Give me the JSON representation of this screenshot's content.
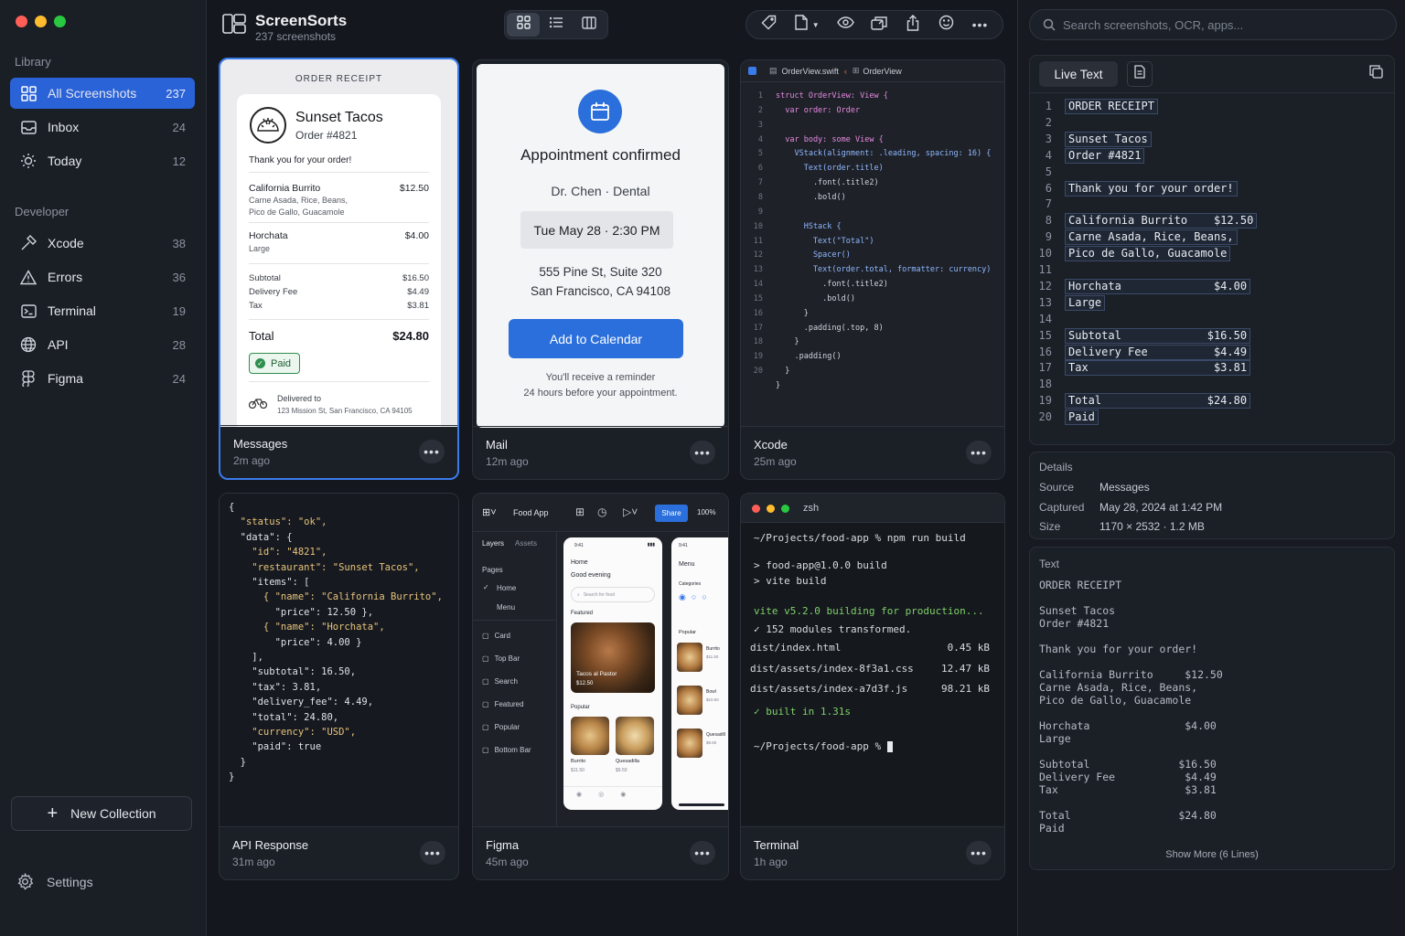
{
  "app": {
    "title": "ScreenSorts",
    "subtitle": "237 screenshots"
  },
  "sidebar": {
    "library_label": "Library",
    "developer_label": "Developer",
    "library": [
      {
        "label": "All Screenshots",
        "count": "237",
        "icon": "grid-icon"
      },
      {
        "label": "Inbox",
        "count": "24",
        "icon": "inbox-icon"
      },
      {
        "label": "Today",
        "count": "12",
        "icon": "sun-icon"
      }
    ],
    "developer": [
      {
        "label": "Xcode",
        "count": "38",
        "icon": "hammer-icon"
      },
      {
        "label": "Errors",
        "count": "36",
        "icon": "warning-icon"
      },
      {
        "label": "Terminal",
        "count": "19",
        "icon": "terminal-icon"
      },
      {
        "label": "API",
        "count": "28",
        "icon": "globe-icon"
      },
      {
        "label": "Figma",
        "count": "24",
        "icon": "figma-icon"
      }
    ],
    "new_collection": "New Collection",
    "settings": "Settings"
  },
  "search": {
    "placeholder": "Search screenshots, OCR, apps..."
  },
  "cards": [
    {
      "name": "Messages",
      "time": "2m ago"
    },
    {
      "name": "Mail",
      "time": "12m ago"
    },
    {
      "name": "Xcode",
      "time": "25m ago"
    },
    {
      "name": "API Response",
      "time": "31m ago"
    },
    {
      "name": "Figma",
      "time": "45m ago"
    },
    {
      "name": "Terminal",
      "time": "1h ago"
    }
  ],
  "receipt": {
    "header": "ORDER RECEIPT",
    "restaurant": "Sunset Tacos",
    "order": "Order #4821",
    "thanks": "Thank you for your order!",
    "item1": "California Burrito",
    "item1_price": "$12.50",
    "item1_desc1": "Carne Asada, Rice, Beans,",
    "item1_desc2": "Pico de Gallo, Guacamole",
    "item2": "Horchata",
    "item2_price": "$4.00",
    "item2_desc": "Large",
    "subtotal_l": "Subtotal",
    "subtotal": "$16.50",
    "fee_l": "Delivery Fee",
    "fee": "$4.49",
    "tax_l": "Tax",
    "tax": "$3.81",
    "total_l": "Total",
    "total": "$24.80",
    "paid": "Paid",
    "delivered_l": "Delivered to",
    "address": "123 Mission St, San Francisco, CA 94105"
  },
  "mail": {
    "title": "Appointment confirmed",
    "doctor": "Dr. Chen · Dental",
    "time": "Tue May 28 · 2:30 PM",
    "addr1": "555 Pine St, Suite 320",
    "addr2": "San Francisco, CA 94108",
    "button": "Add to Calendar",
    "note1": "You'll receive a reminder",
    "note2": "24 hours before your appointment."
  },
  "xcode": {
    "file": "OrderView.swift",
    "crumb": "OrderView",
    "lines": [
      "struct OrderView: View {",
      "  var order: Order",
      "",
      "  var body: some View {",
      "    VStack(alignment: .leading, spacing: 16) {",
      "      Text(order.title)",
      "        .font(.title2)",
      "        .bold()",
      "",
      "      HStack {",
      "        Text(\"Total\")",
      "        Spacer()",
      "        Text(order.total, formatter: currency)",
      "          .font(.title2)",
      "          .bold()",
      "      }",
      "      .padding(.top, 8)",
      "    }",
      "    .padding()",
      "  }",
      "}"
    ],
    "line_numbers": [
      "1",
      "2",
      "3",
      "4",
      "5",
      "6",
      "7",
      "8",
      "9",
      "10",
      "11",
      "12",
      "13",
      "14",
      "15",
      "16",
      "17",
      "18",
      "19",
      "20"
    ]
  },
  "api": {
    "lines": [
      "{",
      "  \"status\": \"ok\",",
      "  \"data\": {",
      "    \"id\": \"4821\",",
      "    \"restaurant\": \"Sunset Tacos\",",
      "    \"items\": [",
      "      { \"name\": \"California Burrito\",",
      "        \"price\": 12.50 },",
      "      { \"name\": \"Horchata\",",
      "        \"price\": 4.00 }",
      "    ],",
      "    \"subtotal\": 16.50,",
      "    \"tax\": 3.81,",
      "    \"delivery_fee\": 4.49,",
      "    \"total\": 24.80,",
      "    \"currency\": \"USD\",",
      "    \"paid\": true",
      "  }",
      "}"
    ]
  },
  "figma": {
    "file": "Food App",
    "share": "Share",
    "zoom": "100%",
    "layers": "Layers",
    "assets": "Assets",
    "pages": "Pages",
    "page_items": [
      "Home",
      "Menu"
    ],
    "layer_items": [
      "Card",
      "Top Bar",
      "Search",
      "Featured",
      "Popular",
      "Bottom Bar"
    ],
    "phone1": {
      "time": "9:41",
      "home": "Home",
      "greeting": "Good evening",
      "search": "Search for food",
      "featured": "Featured",
      "dish": "Tacos al Pastor",
      "dish_price": "$12.50",
      "popular": "Popular",
      "p1": "Burrito",
      "p1_price": "$11.50",
      "p2": "Quesadilla",
      "p2_price": "$9.50"
    },
    "phone2": {
      "time": "9:41",
      "title": "Menu",
      "categories": "Categories",
      "popular": "Popular",
      "items": [
        {
          "name": "Burrito",
          "price": "$11.50"
        },
        {
          "name": "Bowl",
          "price": "$10.50"
        },
        {
          "name": "Quesadill",
          "price": "$9.50"
        }
      ]
    }
  },
  "terminal": {
    "title": "zsh",
    "prompt1": "~/Projects/food-app % npm run build",
    "l1": "> food-app@1.0.0 build",
    "l2": "> vite build",
    "l3": "vite v5.2.0 building for production...",
    "l4": "✓ 152 modules transformed.",
    "files": [
      {
        "name": "dist/index.html",
        "size": "0.45 kB"
      },
      {
        "name": "dist/assets/index-8f3a1.css",
        "size": "12.47 kB"
      },
      {
        "name": "dist/assets/index-a7d3f.js",
        "size": "98.21 kB"
      }
    ],
    "built": "✓ built in 1.31s",
    "prompt2": "~/Projects/food-app % "
  },
  "live_text": {
    "tab": "Live Text",
    "lines": [
      {
        "n": "1",
        "t": "ORDER RECEIPT"
      },
      {
        "n": "2",
        "t": ""
      },
      {
        "n": "3",
        "t": "Sunset Tacos"
      },
      {
        "n": "4",
        "t": "Order #4821"
      },
      {
        "n": "5",
        "t": ""
      },
      {
        "n": "6",
        "t": "Thank you for your order!"
      },
      {
        "n": "7",
        "t": ""
      },
      {
        "n": "8",
        "t": "California Burrito    $12.50"
      },
      {
        "n": "9",
        "t": "Carne Asada, Rice, Beans,"
      },
      {
        "n": "10",
        "t": "Pico de Gallo, Guacamole"
      },
      {
        "n": "11",
        "t": ""
      },
      {
        "n": "12",
        "t": "Horchata              $4.00"
      },
      {
        "n": "13",
        "t": "Large"
      },
      {
        "n": "14",
        "t": ""
      },
      {
        "n": "15",
        "t": "Subtotal             $16.50"
      },
      {
        "n": "16",
        "t": "Delivery Fee          $4.49"
      },
      {
        "n": "17",
        "t": "Tax                   $3.81"
      },
      {
        "n": "18",
        "t": ""
      },
      {
        "n": "19",
        "t": "Total                $24.80"
      },
      {
        "n": "20",
        "t": "Paid"
      }
    ]
  },
  "details": {
    "heading": "Details",
    "rows": [
      {
        "k": "Source",
        "v": "Messages"
      },
      {
        "k": "Captured",
        "v": "May 28, 2024 at 1:42 PM"
      },
      {
        "k": "Size",
        "v": "1170 × 2532 · 1.2 MB"
      }
    ]
  },
  "text_panel": {
    "heading": "Text",
    "body": "ORDER RECEIPT\n\nSunset Tacos\nOrder #4821\n\nThank you for your order!\n\nCalifornia Burrito     $12.50\nCarne Asada, Rice, Beans,\nPico de Gallo, Guacamole\n\nHorchata               $4.00\nLarge\n\nSubtotal              $16.50\nDelivery Fee           $4.49\nTax                    $3.81\n\nTotal                 $24.80\nPaid",
    "show_more": "Show More (6 Lines)"
  },
  "colors": {
    "accent": "#2a62d8",
    "selection": "#3a7bec",
    "mail_blue": "#2a6fdb",
    "paid_green": "#2f8f4e"
  }
}
